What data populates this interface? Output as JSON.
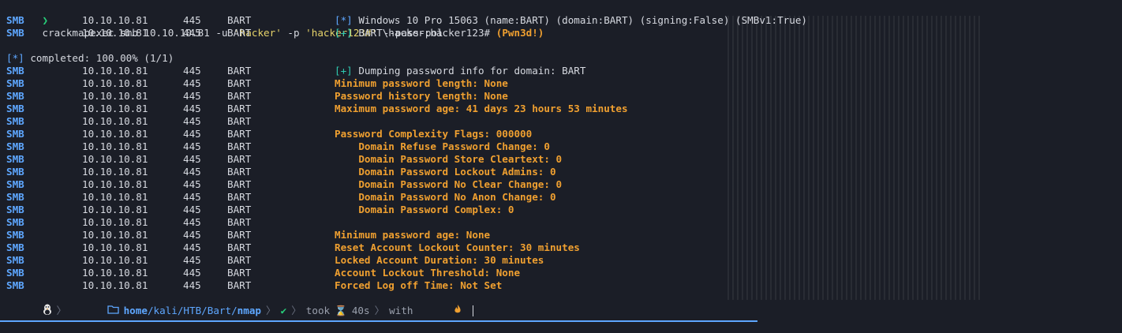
{
  "prompt": {
    "arrow": "❯",
    "cmd": "crackmapexec smb 10.10.10.81 -u ",
    "arg_user": "'hacker'",
    "mid": " -p ",
    "arg_pass": "'hacker123#'",
    "tail": " --pass-pol"
  },
  "rows": [
    {
      "proto": "SMB",
      "ip": "10.10.10.81",
      "port": "445",
      "host": "BART",
      "tag": "[*]",
      "tag_color": "blue",
      "msg": " Windows 10 Pro 15063 (name:BART) (domain:BART) (signing:False) (SMBv1:True)",
      "style": "plain"
    },
    {
      "proto": "SMB",
      "ip": "10.10.10.81",
      "port": "445",
      "host": "BART",
      "tag": "[+]",
      "tag_color": "teal",
      "msg": " BART\\hacker:hacker123# ",
      "extra": "(Pwn3d!)",
      "style": "plain"
    },
    {
      "blank": true
    },
    {
      "status_tag": "[*]",
      "status": " completed: 100.00% (1/1)"
    },
    {
      "proto": "SMB",
      "ip": "10.10.10.81",
      "port": "445",
      "host": "BART",
      "tag": "[+]",
      "tag_color": "teal",
      "msg": " Dumping password info for domain: BART",
      "style": "plain"
    },
    {
      "proto": "SMB",
      "ip": "10.10.10.81",
      "port": "445",
      "host": "BART",
      "msg": "Minimum password length: None",
      "style": "orange"
    },
    {
      "proto": "SMB",
      "ip": "10.10.10.81",
      "port": "445",
      "host": "BART",
      "msg": "Password history length: None",
      "style": "orange"
    },
    {
      "proto": "SMB",
      "ip": "10.10.10.81",
      "port": "445",
      "host": "BART",
      "msg": "Maximum password age: 41 days 23 hours 53 minutes",
      "style": "orange"
    },
    {
      "proto": "SMB",
      "ip": "10.10.10.81",
      "port": "445",
      "host": "BART",
      "msg": "",
      "style": "orange"
    },
    {
      "proto": "SMB",
      "ip": "10.10.10.81",
      "port": "445",
      "host": "BART",
      "msg": "Password Complexity Flags: 000000",
      "style": "orange"
    },
    {
      "proto": "SMB",
      "ip": "10.10.10.81",
      "port": "445",
      "host": "BART",
      "msg": "    Domain Refuse Password Change: 0",
      "style": "orange"
    },
    {
      "proto": "SMB",
      "ip": "10.10.10.81",
      "port": "445",
      "host": "BART",
      "msg": "    Domain Password Store Cleartext: 0",
      "style": "orange"
    },
    {
      "proto": "SMB",
      "ip": "10.10.10.81",
      "port": "445",
      "host": "BART",
      "msg": "    Domain Password Lockout Admins: 0",
      "style": "orange"
    },
    {
      "proto": "SMB",
      "ip": "10.10.10.81",
      "port": "445",
      "host": "BART",
      "msg": "    Domain Password No Clear Change: 0",
      "style": "orange"
    },
    {
      "proto": "SMB",
      "ip": "10.10.10.81",
      "port": "445",
      "host": "BART",
      "msg": "    Domain Password No Anon Change: 0",
      "style": "orange"
    },
    {
      "proto": "SMB",
      "ip": "10.10.10.81",
      "port": "445",
      "host": "BART",
      "msg": "    Domain Password Complex: 0",
      "style": "orange"
    },
    {
      "proto": "SMB",
      "ip": "10.10.10.81",
      "port": "445",
      "host": "BART",
      "msg": "",
      "style": "orange"
    },
    {
      "proto": "SMB",
      "ip": "10.10.10.81",
      "port": "445",
      "host": "BART",
      "msg": "Minimum password age: None",
      "style": "orange"
    },
    {
      "proto": "SMB",
      "ip": "10.10.10.81",
      "port": "445",
      "host": "BART",
      "msg": "Reset Account Lockout Counter: 30 minutes",
      "style": "orange"
    },
    {
      "proto": "SMB",
      "ip": "10.10.10.81",
      "port": "445",
      "host": "BART",
      "msg": "Locked Account Duration: 30 minutes",
      "style": "orange"
    },
    {
      "proto": "SMB",
      "ip": "10.10.10.81",
      "port": "445",
      "host": "BART",
      "msg": "Account Lockout Threshold: None",
      "style": "orange"
    },
    {
      "proto": "SMB",
      "ip": "10.10.10.81",
      "port": "445",
      "host": "BART",
      "msg": "Forced Log off Time: Not Set",
      "style": "orange"
    }
  ],
  "statusline": {
    "os_icon": "linux-penguin-icon",
    "folder_icon": "folder-icon",
    "path_home": "home",
    "path_mid": "/kali/HTB/Bart/",
    "path_cur": "nmap",
    "check": "✔",
    "took_label": "took",
    "hourglass": "⌛",
    "took_value": "40s",
    "with_label": "with",
    "flame_icon": "flame-icon"
  },
  "colors": {
    "accent": "#5ea7ff",
    "orange": "#f0a030",
    "teal": "#2fc9b0",
    "green": "#27d07a",
    "bg": "#1b1e27"
  }
}
